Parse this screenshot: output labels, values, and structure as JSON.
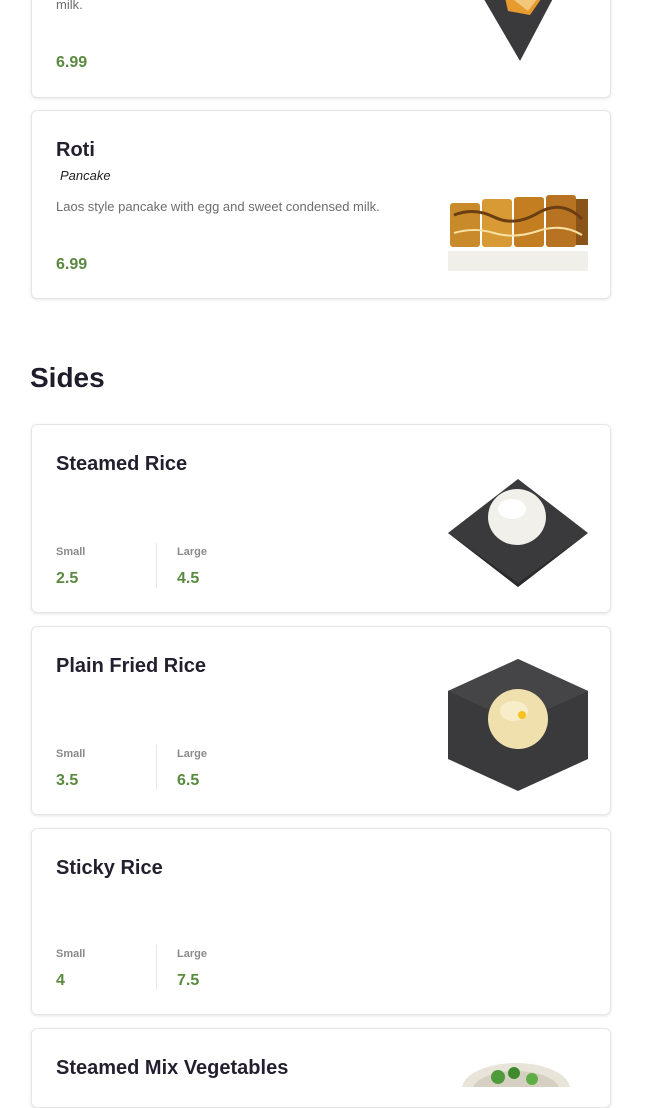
{
  "dessert_items": [
    {
      "desc_fragment": "milk.",
      "price": "6.99"
    },
    {
      "name": "Roti",
      "subtitle": "Pancake",
      "description": "Laos style pancake with egg and sweet condensed milk.",
      "price": "6.99"
    }
  ],
  "sides": {
    "heading": "Sides",
    "items": [
      {
        "name": "Steamed Rice",
        "small_label": "Small",
        "small_price": "2.5",
        "large_label": "Large",
        "large_price": "4.5"
      },
      {
        "name": "Plain Fried Rice",
        "small_label": "Small",
        "small_price": "3.5",
        "large_label": "Large",
        "large_price": "6.5"
      },
      {
        "name": "Sticky Rice",
        "small_label": "Small",
        "small_price": "4",
        "large_label": "Large",
        "large_price": "7.5"
      },
      {
        "name": "Steamed Mix Vegetables"
      }
    ]
  },
  "colors": {
    "price_green": "#5a8a3f",
    "title_dark": "#231f2e",
    "plate_dark": "#3a3a3c"
  }
}
